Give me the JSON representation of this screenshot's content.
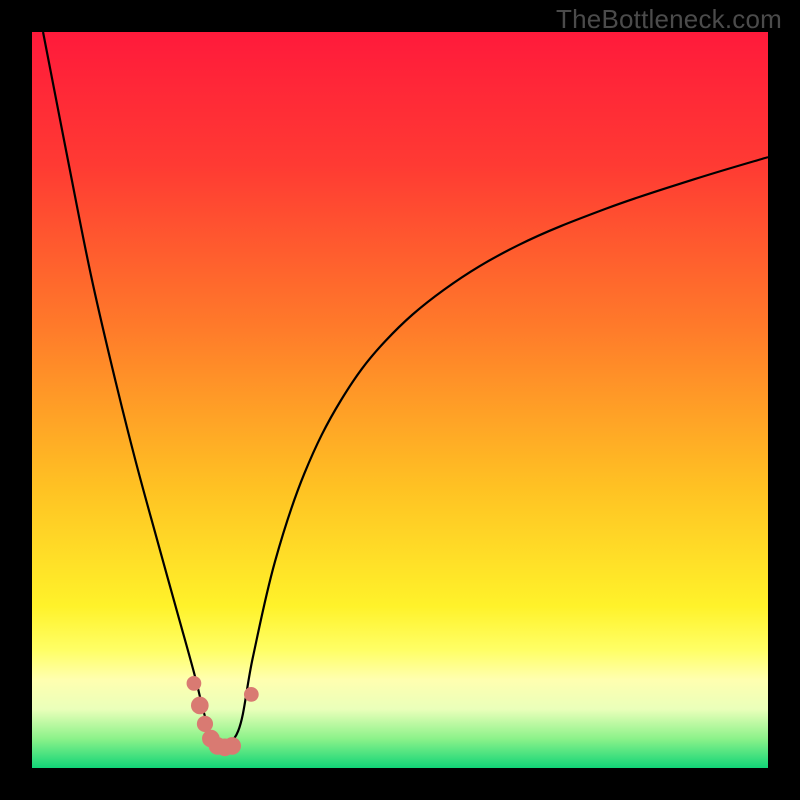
{
  "watermark": "TheBottleneck.com",
  "colors": {
    "frame": "#000000",
    "curve": "#000000",
    "marker": "#d97a72",
    "gradient_stops": [
      {
        "pct": 0,
        "color": "#ff1a3b"
      },
      {
        "pct": 18,
        "color": "#ff3a33"
      },
      {
        "pct": 40,
        "color": "#ff7a2a"
      },
      {
        "pct": 62,
        "color": "#ffc223"
      },
      {
        "pct": 78,
        "color": "#fff22a"
      },
      {
        "pct": 84,
        "color": "#ffff66"
      },
      {
        "pct": 88,
        "color": "#ffffb0"
      },
      {
        "pct": 92,
        "color": "#eaffba"
      },
      {
        "pct": 96,
        "color": "#8cf28a"
      },
      {
        "pct": 100,
        "color": "#11d477"
      }
    ]
  },
  "chart_data": {
    "type": "line",
    "title": "",
    "xlabel": "",
    "ylabel": "",
    "xlim": [
      0,
      100
    ],
    "ylim": [
      0,
      100
    ],
    "grid": false,
    "legend": false,
    "series": [
      {
        "name": "bottleneck-curve-left",
        "x": [
          1.5,
          5,
          8,
          11,
          14,
          17,
          19.5,
          22,
          23.5,
          25
        ],
        "y": [
          100,
          82,
          67,
          54,
          42,
          31,
          22,
          13,
          7,
          2.5
        ]
      },
      {
        "name": "bottleneck-curve-right",
        "x": [
          25,
          28,
          30,
          33,
          37,
          42,
          48,
          56,
          66,
          78,
          90,
          100
        ],
        "y": [
          2.5,
          5,
          15,
          28,
          40,
          50,
          58,
          65,
          71,
          76,
          80,
          83
        ]
      }
    ],
    "markers": {
      "name": "highlighted-points",
      "color": "#d97a72",
      "points": [
        {
          "x": 22.0,
          "y": 11.5,
          "r": 1.0
        },
        {
          "x": 22.8,
          "y": 8.5,
          "r": 1.2
        },
        {
          "x": 23.5,
          "y": 6.0,
          "r": 1.1
        },
        {
          "x": 24.3,
          "y": 4.0,
          "r": 1.2
        },
        {
          "x": 25.2,
          "y": 3.0,
          "r": 1.2
        },
        {
          "x": 26.2,
          "y": 2.8,
          "r": 1.2
        },
        {
          "x": 27.2,
          "y": 3.0,
          "r": 1.2
        },
        {
          "x": 29.8,
          "y": 10.0,
          "r": 1.0
        }
      ]
    }
  }
}
